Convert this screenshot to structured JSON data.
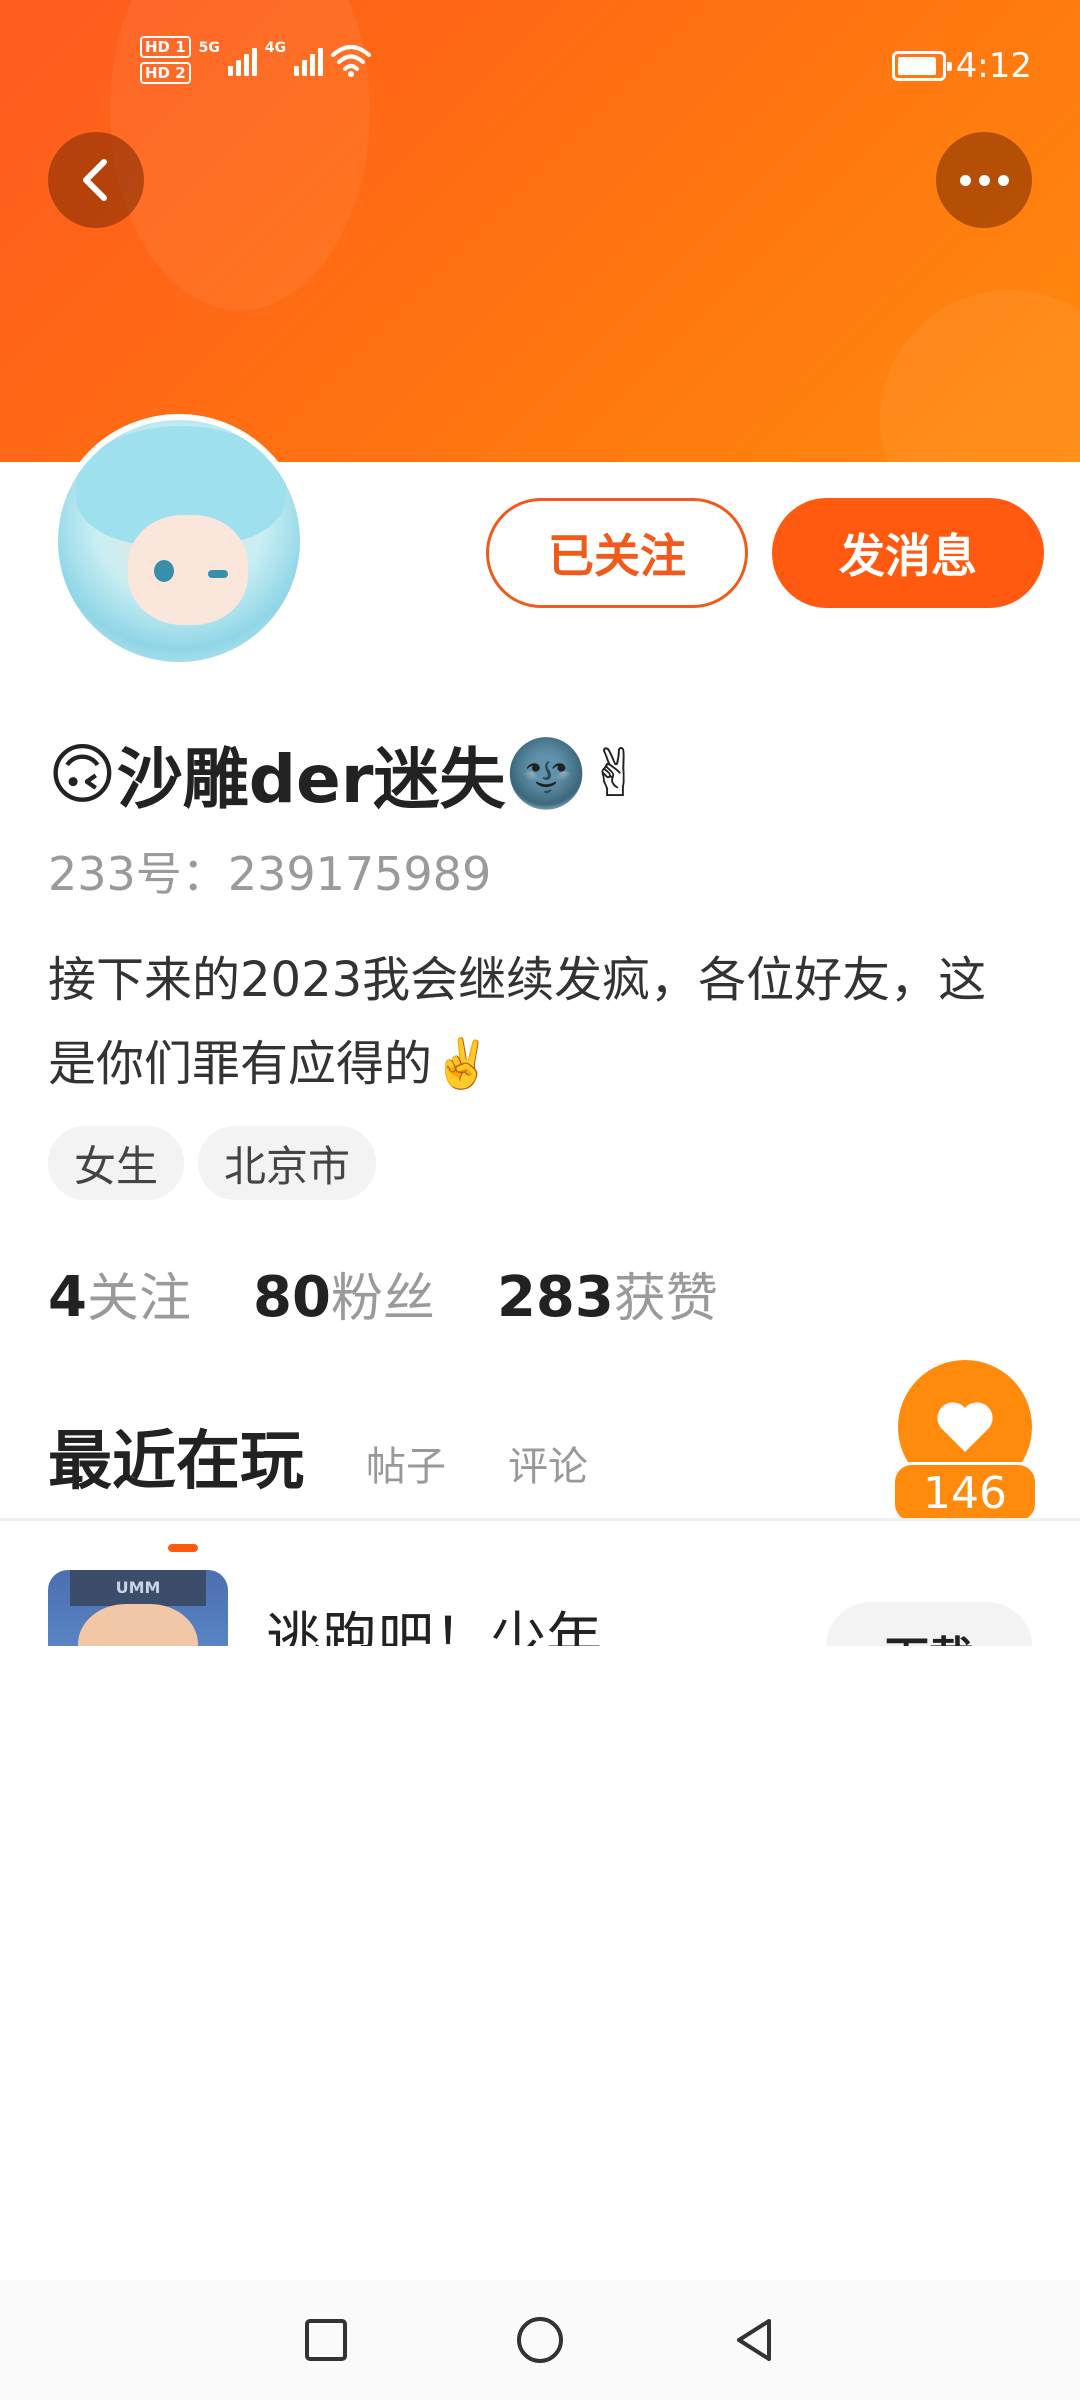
{
  "status_bar": {
    "sim1_label": "HD 1",
    "sim2_label": "HD 2",
    "network1": "5G",
    "network2": "4G",
    "time": "4:12",
    "icons": [
      "signal-icon",
      "wifi-icon",
      "battery-icon"
    ]
  },
  "header": {
    "back_icon": "chevron-left-icon",
    "more_icon": "more-dots-icon",
    "gradient_start": "#ff5a1f",
    "gradient_end": "#ff8a0c"
  },
  "profile": {
    "follow_label": "已关注",
    "message_label": "发消息",
    "name_prefix_emoji": "🙃",
    "name": "沙雕der迷失",
    "name_suffix_emoji": "🌚✌",
    "id_label": "233号：",
    "id_value": "239175989",
    "bio": "接下来的2023我会继续发疯，各位好友，这是你们罪有应得的✌️",
    "tags": [
      "女生",
      "北京市"
    ]
  },
  "stats": {
    "following_count": "4",
    "following_label": "关注",
    "fans_count": "80",
    "fans_label": "粉丝",
    "likes_count": "283",
    "likes_label": "获赞"
  },
  "tabs": {
    "active": "最近在玩",
    "posts": "帖子",
    "comments": "评论"
  },
  "like_badge": {
    "count": "146",
    "icon": "heart-icon"
  },
  "recent_games": [
    {
      "thumb_text": "UMM",
      "title": "逃跑吧！少年",
      "button": "下载"
    }
  ],
  "accent_color": "#ff5a0f",
  "nav_bar": {
    "icons": [
      "square-icon",
      "circle-home-icon",
      "triangle-back-icon"
    ]
  }
}
